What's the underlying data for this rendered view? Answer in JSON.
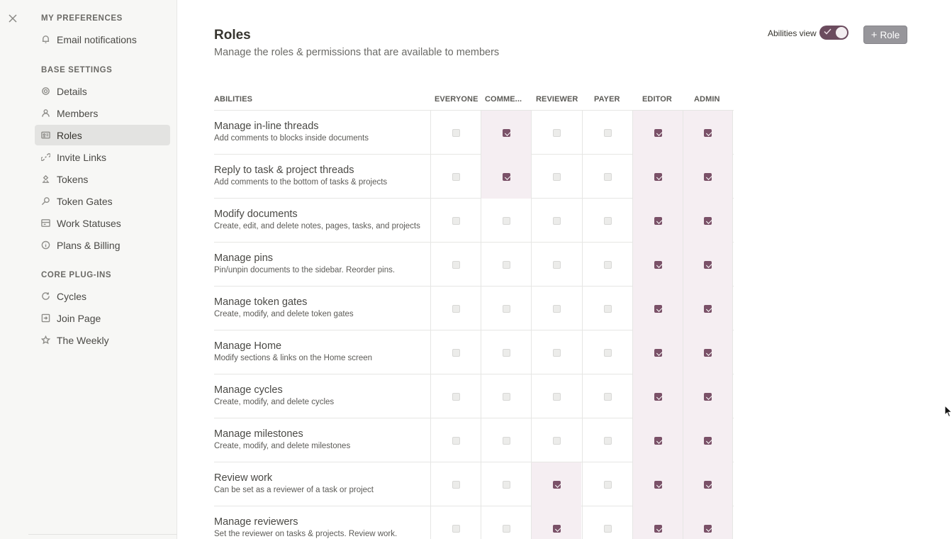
{
  "sidebar": {
    "sections": [
      {
        "title": "MY PREFERENCES",
        "items": [
          {
            "label": "Email notifications",
            "icon": "bell-icon"
          }
        ]
      },
      {
        "title": "BASE SETTINGS",
        "items": [
          {
            "label": "Details",
            "icon": "gear-icon"
          },
          {
            "label": "Members",
            "icon": "user-icon"
          },
          {
            "label": "Roles",
            "icon": "id-card-icon",
            "active": true
          },
          {
            "label": "Invite Links",
            "icon": "link-icon"
          },
          {
            "label": "Tokens",
            "icon": "token-icon"
          },
          {
            "label": "Token Gates",
            "icon": "key-icon"
          },
          {
            "label": "Work Statuses",
            "icon": "board-icon"
          },
          {
            "label": "Plans & Billing",
            "icon": "info-circle-icon"
          }
        ]
      },
      {
        "title": "CORE PLUG-INS",
        "items": [
          {
            "label": "Cycles",
            "icon": "refresh-icon"
          },
          {
            "label": "Join Page",
            "icon": "join-page-icon"
          },
          {
            "label": "The Weekly",
            "icon": "star-icon"
          }
        ]
      }
    ]
  },
  "header": {
    "title": "Roles",
    "subtitle": "Manage the roles & permissions that are available to members",
    "abilities_view_label": "Abilities view",
    "abilities_view_on": true,
    "role_button_label": "Role"
  },
  "table": {
    "abilities_header": "ABILITIES",
    "columns": [
      "EVERYONE",
      "COMME...",
      "REVIEWER",
      "PAYER",
      "EDITOR",
      "ADMIN"
    ],
    "rows": [
      {
        "title": "Manage in-line threads",
        "desc": "Add comments to blocks inside documents",
        "checks": [
          false,
          true,
          false,
          false,
          true,
          true
        ]
      },
      {
        "title": "Reply to task & project threads",
        "desc": "Add comments to the bottom of tasks & projects",
        "checks": [
          false,
          true,
          false,
          false,
          true,
          true
        ]
      },
      {
        "title": "Modify documents",
        "desc": "Create, edit, and delete notes, pages, tasks, and projects",
        "checks": [
          false,
          false,
          false,
          false,
          true,
          true
        ]
      },
      {
        "title": "Manage pins",
        "desc": "Pin/unpin documents to the sidebar. Reorder pins.",
        "checks": [
          false,
          false,
          false,
          false,
          true,
          true
        ]
      },
      {
        "title": "Manage token gates",
        "desc": "Create, modify, and delete token gates",
        "checks": [
          false,
          false,
          false,
          false,
          true,
          true
        ]
      },
      {
        "title": "Manage Home",
        "desc": "Modify sections & links on the Home screen",
        "checks": [
          false,
          false,
          false,
          false,
          true,
          true
        ]
      },
      {
        "title": "Manage cycles",
        "desc": "Create, modify, and delete cycles",
        "checks": [
          false,
          false,
          false,
          false,
          true,
          true
        ]
      },
      {
        "title": "Manage milestones",
        "desc": "Create, modify, and delete milestones",
        "checks": [
          false,
          false,
          false,
          false,
          true,
          true
        ]
      },
      {
        "title": "Review work",
        "desc": "Can be set as a reviewer of a task or project",
        "checks": [
          false,
          false,
          true,
          false,
          true,
          true
        ]
      },
      {
        "title": "Manage reviewers",
        "desc": "Set the reviewer on tasks & projects. Review work.",
        "checks": [
          false,
          false,
          true,
          false,
          true,
          true
        ]
      }
    ]
  },
  "colors": {
    "accent": "#7a5168",
    "highlight": "#f5eef2",
    "toggle": "#6b4b5e",
    "role_button": "#97969b"
  }
}
